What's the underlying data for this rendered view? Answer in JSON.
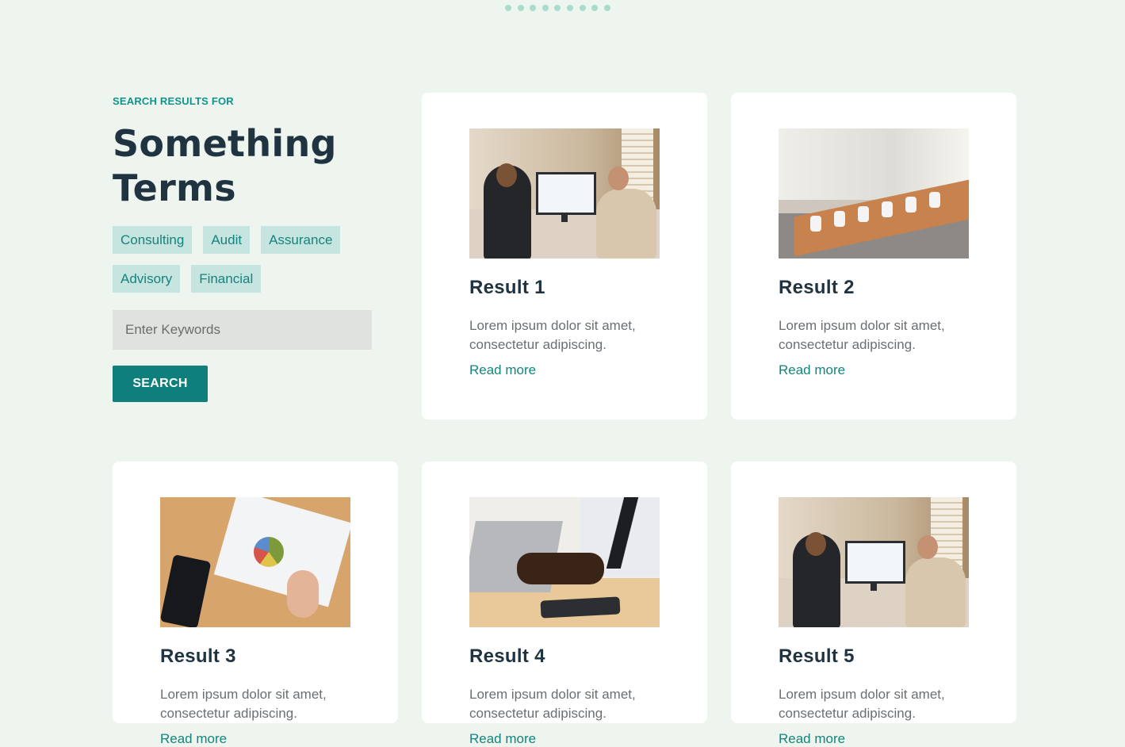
{
  "pager": {
    "count": 9
  },
  "search_panel": {
    "eyebrow": "SEARCH RESULTS FOR",
    "title_line1": "Something",
    "title_line2": "Terms",
    "tags": [
      "Consulting",
      "Audit",
      "Assurance",
      "Advisory",
      "Financial"
    ],
    "input_placeholder": "Enter Keywords",
    "button_label": "SEARCH"
  },
  "results": [
    {
      "title": "Result 1",
      "text_line1": "Lorem ipsum dolor sit amet,",
      "text_line2": "consectetur adipiscing.",
      "link": "Read more",
      "image": "office-meeting"
    },
    {
      "title": "Result 2",
      "text_line1": "Lorem ipsum dolor sit amet,",
      "text_line2": "consectetur adipiscing.",
      "link": "Read more",
      "image": "conference-room"
    },
    {
      "title": "Result 3",
      "text_line1": "Lorem ipsum dolor sit amet,",
      "text_line2": "consectetur adipiscing.",
      "link": "Read more",
      "image": "charts-phone"
    },
    {
      "title": "Result 4",
      "text_line1": "Lorem ipsum dolor sit amet,",
      "text_line2": "consectetur adipiscing.",
      "link": "Read more",
      "image": "laptop-typing"
    },
    {
      "title": "Result 5",
      "text_line1": "Lorem ipsum dolor sit amet,",
      "text_line2": "consectetur adipiscing.",
      "link": "Read more",
      "image": "office-meeting"
    }
  ],
  "colors": {
    "background": "#eef4ee",
    "accent": "#0f7f7c",
    "tag_bg": "#c6e4e0",
    "heading": "#1f3340"
  }
}
